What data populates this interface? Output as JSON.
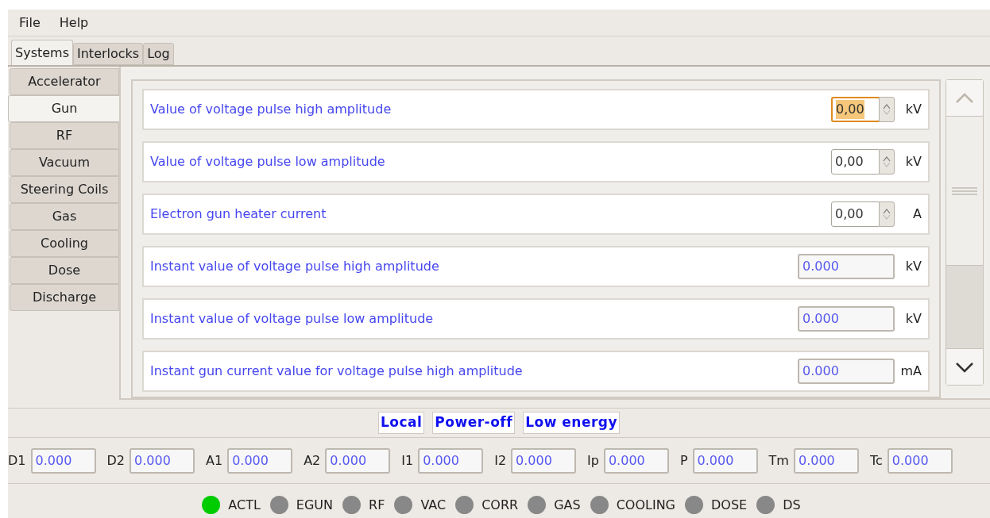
{
  "menu": [
    "File",
    "Help"
  ],
  "tabs": [
    {
      "label": "Systems",
      "selected": true
    },
    {
      "label": "Interlocks",
      "selected": false
    },
    {
      "label": "Log",
      "selected": false
    }
  ],
  "side_tabs": [
    {
      "label": "Accelerator",
      "selected": false
    },
    {
      "label": "Gun",
      "selected": true
    },
    {
      "label": "RF",
      "selected": false
    },
    {
      "label": "Vacuum",
      "selected": false
    },
    {
      "label": "Steering Coils",
      "selected": false
    },
    {
      "label": "Gas",
      "selected": false
    },
    {
      "label": "Cooling",
      "selected": false
    },
    {
      "label": "Dose",
      "selected": false
    },
    {
      "label": "Discharge",
      "selected": false
    }
  ],
  "rows": [
    {
      "kind": "spin",
      "label": "Value of voltage pulse high amplitude",
      "value": "0,00",
      "unit": "kV",
      "focused": true
    },
    {
      "kind": "spin",
      "label": "Value of voltage pulse low amplitude",
      "value": "0,00",
      "unit": "kV",
      "focused": false
    },
    {
      "kind": "spin",
      "label": "Electron gun heater current",
      "value": "0,00",
      "unit": "A",
      "focused": false
    },
    {
      "kind": "readout",
      "label": "Instant value of voltage pulse high amplitude",
      "value": "0.000",
      "unit": "kV"
    },
    {
      "kind": "readout",
      "label": "Instant value of voltage pulse low amplitude",
      "value": "0.000",
      "unit": "kV"
    },
    {
      "kind": "readout",
      "label": "Instant gun current value for voltage pulse high amplitude",
      "value": "0.000",
      "unit": "mA"
    }
  ],
  "modes": [
    "Local",
    "Power-off",
    "Low energy"
  ],
  "readings": [
    {
      "label": "D1",
      "value": "0.000"
    },
    {
      "label": "D2",
      "value": "0.000"
    },
    {
      "label": "A1",
      "value": "0.000"
    },
    {
      "label": "A2",
      "value": "0.000"
    },
    {
      "label": "I1",
      "value": "0.000"
    },
    {
      "label": "I2",
      "value": "0.000"
    },
    {
      "label": "Ip",
      "value": "0.000"
    },
    {
      "label": "P",
      "value": "0.000"
    },
    {
      "label": "Tm",
      "value": "0.000"
    },
    {
      "label": "Tc",
      "value": "0.000"
    }
  ],
  "indicators": [
    {
      "label": "ACTL",
      "color": "#00cc00"
    },
    {
      "label": "EGUN",
      "color": "#888888"
    },
    {
      "label": "RF",
      "color": "#888888"
    },
    {
      "label": "VAC",
      "color": "#888888"
    },
    {
      "label": "CORR",
      "color": "#888888"
    },
    {
      "label": "GAS",
      "color": "#888888"
    },
    {
      "label": "COOLING",
      "color": "#888888"
    },
    {
      "label": "DOSE",
      "color": "#888888"
    },
    {
      "label": "DS",
      "color": "#888888"
    }
  ]
}
